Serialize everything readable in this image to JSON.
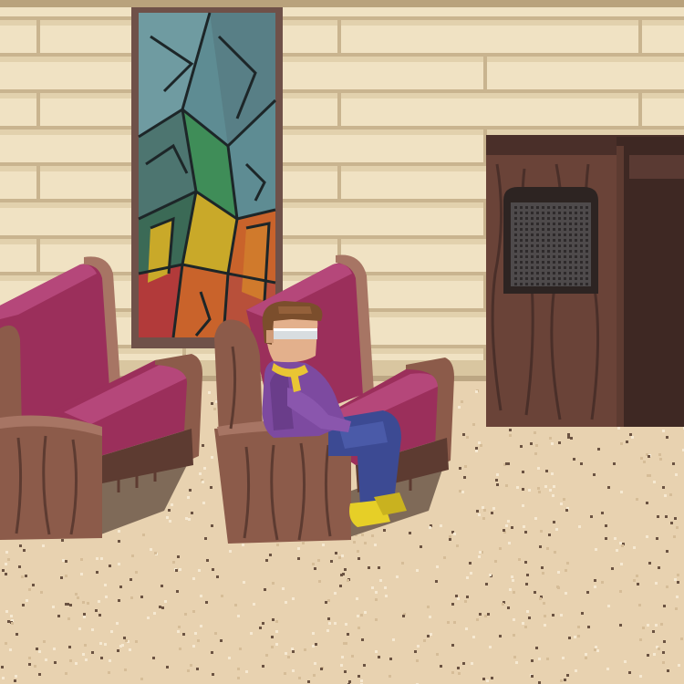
{
  "scene": {
    "description_label": "",
    "palette": {
      "wall": "#f0e2c3",
      "wall_line": "#c9b48f",
      "wall_shadow": "#e2d1ad",
      "carpet": "#e8d2b0",
      "carpet_dot_dark": "#6b5342",
      "carpet_dot_light": "#f6e9d2",
      "wood": "#8c5b4a",
      "wood_dark": "#5d3b31",
      "wood_light": "#a77564",
      "cushion": "#9b2f5b",
      "cushion_light": "#b5477a",
      "cushion_dark": "#6e1f41",
      "window_frame": "#6f5149",
      "glass_blue": "#5e8c93",
      "glass_teal": "#4d7570",
      "glass_green": "#3f8d58",
      "glass_orange": "#c9632b",
      "glass_yellow": "#c9a929",
      "glass_red": "#b23a3a",
      "lead": "#1d2628",
      "character_shirt": "#7d4aa0",
      "character_pants": "#3c4a93",
      "character_shoes": "#e6cf27",
      "character_hair": "#7b4e2c",
      "character_skin": "#e3b08c",
      "character_glasses": "#d8dde0",
      "character_scarf": "#e9c533",
      "confessional_wood": "#6a4338",
      "confessional_dark": "#3e2823",
      "confessional_grille": "#4e4a4b"
    }
  }
}
